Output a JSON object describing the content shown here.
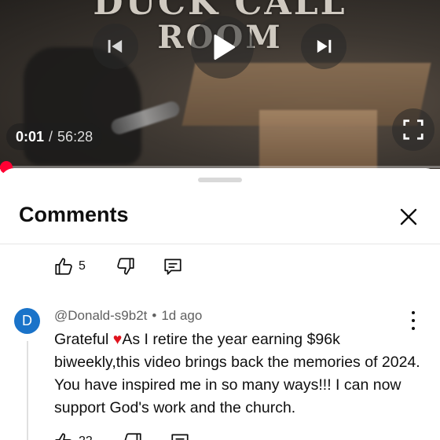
{
  "video": {
    "title_line1": "DUCK CALL",
    "title_line2": "ROOM",
    "current_time": "0:01",
    "separator": "/",
    "duration": "56:28",
    "progress_fraction": 0.0003,
    "accent_color": "#ff0033"
  },
  "sheet": {
    "title": "Comments"
  },
  "comments": [
    {
      "likes": "5"
    },
    {
      "avatar_letter": "D",
      "avatar_color": "#1a73c9",
      "author": "@Donald-s9b2t",
      "meta_separator": "•",
      "time": "1d ago",
      "text_before_emoji": "Grateful ",
      "emoji": "♥",
      "text_after_emoji": "As I retire the year earning $96k biweekly,this video brings back the memories of 2024. You have inspired me in so many ways!!! I can now support God's work and the church.",
      "likes": "22"
    }
  ]
}
